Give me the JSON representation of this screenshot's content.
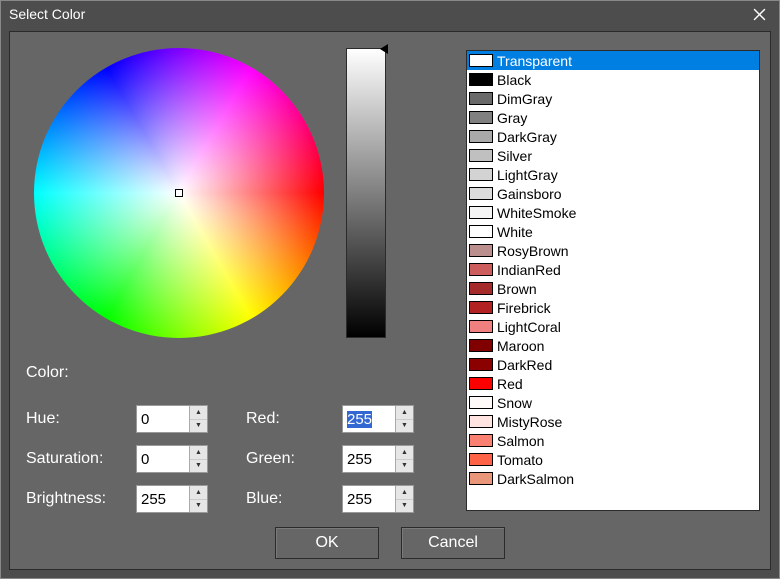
{
  "title": "Select Color",
  "color_label": "Color:",
  "fields": {
    "hue": {
      "label": "Hue:",
      "value": "0"
    },
    "sat": {
      "label": "Saturation:",
      "value": "0"
    },
    "bri": {
      "label": "Brightness:",
      "value": "255"
    },
    "red": {
      "label": "Red:",
      "value": "255"
    },
    "green": {
      "label": "Green:",
      "value": "255"
    },
    "blue": {
      "label": "Blue:",
      "value": "255"
    }
  },
  "buttons": {
    "ok": "OK",
    "cancel": "Cancel"
  },
  "selected_index": 0,
  "colors": [
    {
      "name": "Transparent",
      "hex": "#ffffff"
    },
    {
      "name": "Black",
      "hex": "#000000"
    },
    {
      "name": "DimGray",
      "hex": "#696969"
    },
    {
      "name": "Gray",
      "hex": "#808080"
    },
    {
      "name": "DarkGray",
      "hex": "#a9a9a9"
    },
    {
      "name": "Silver",
      "hex": "#c0c0c0"
    },
    {
      "name": "LightGray",
      "hex": "#d3d3d3"
    },
    {
      "name": "Gainsboro",
      "hex": "#dcdcdc"
    },
    {
      "name": "WhiteSmoke",
      "hex": "#f5f5f5"
    },
    {
      "name": "White",
      "hex": "#ffffff"
    },
    {
      "name": "RosyBrown",
      "hex": "#bc8f8f"
    },
    {
      "name": "IndianRed",
      "hex": "#cd5c5c"
    },
    {
      "name": "Brown",
      "hex": "#a52a2a"
    },
    {
      "name": "Firebrick",
      "hex": "#b22222"
    },
    {
      "name": "LightCoral",
      "hex": "#f08080"
    },
    {
      "name": "Maroon",
      "hex": "#800000"
    },
    {
      "name": "DarkRed",
      "hex": "#8b0000"
    },
    {
      "name": "Red",
      "hex": "#ff0000"
    },
    {
      "name": "Snow",
      "hex": "#fffafa"
    },
    {
      "name": "MistyRose",
      "hex": "#ffe4e1"
    },
    {
      "name": "Salmon",
      "hex": "#fa8072"
    },
    {
      "name": "Tomato",
      "hex": "#ff6347"
    },
    {
      "name": "DarkSalmon",
      "hex": "#e9967a"
    }
  ]
}
